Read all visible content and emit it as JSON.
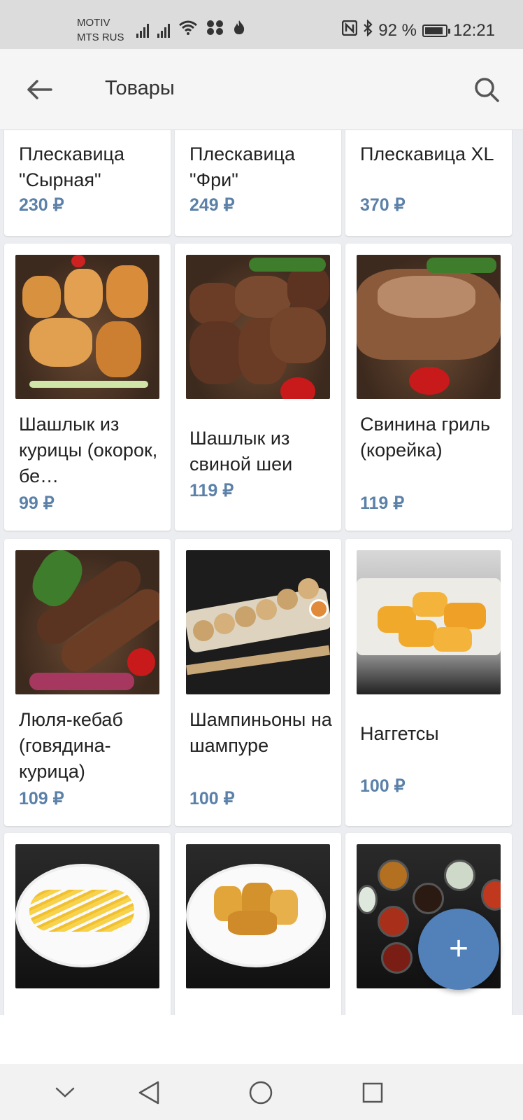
{
  "status_bar": {
    "carrier_line1": "MOTIV",
    "carrier_line2": "MTS RUS",
    "battery_text": "92 %",
    "battery_level": 0.92,
    "time": "12:21"
  },
  "header": {
    "title": "Товары",
    "back_icon": "arrow-left-icon",
    "search_icon": "search-icon"
  },
  "products": [
    {
      "name": "Плескавица \"Сырная\"",
      "price": "230 ₽"
    },
    {
      "name": "Плескавица \"Фри\"",
      "price": "249 ₽"
    },
    {
      "name": "Плескавица XL",
      "price": "370 ₽"
    },
    {
      "name": "Шашлык из курицы (окорок, бе…",
      "price": "99 ₽"
    },
    {
      "name": "Шашлык из свиной шеи",
      "price": "119 ₽"
    },
    {
      "name": "Свинина гриль (корейка)",
      "price": "119 ₽"
    },
    {
      "name": "Люля-кебаб (говядина-курица)",
      "price": "109 ₽"
    },
    {
      "name": "Шампиньоны на шампуре",
      "price": "100 ₽"
    },
    {
      "name": "Наггетсы",
      "price": "100 ₽"
    },
    {
      "name": "",
      "price": ""
    },
    {
      "name": "",
      "price": ""
    },
    {
      "name": "",
      "price": ""
    }
  ],
  "fab": {
    "label": "+",
    "accent": "#5181b8"
  },
  "colors": {
    "price": "#5b81a8",
    "accent": "#5181b8"
  },
  "nav": {
    "collapse_icon": "chevron-down-icon",
    "back_icon": "triangle-back-icon",
    "home_icon": "circle-home-icon",
    "recents_icon": "square-recents-icon"
  }
}
